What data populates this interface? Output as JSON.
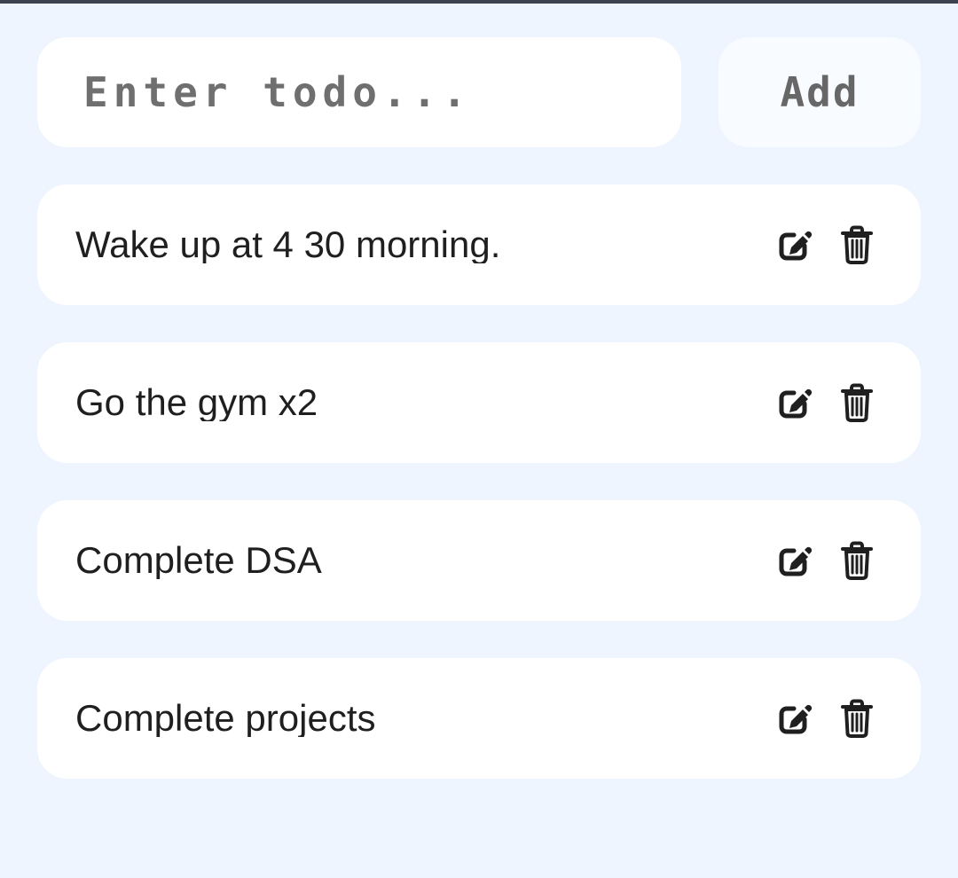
{
  "todo_input": {
    "placeholder": "Enter todo...",
    "value": ""
  },
  "add_button": {
    "label": "Add"
  },
  "todos": [
    {
      "text": "Wake up at 4 30 morning.",
      "edit_icon": "edit-icon",
      "delete_icon": "trash-icon"
    },
    {
      "text": "Go the gym x2",
      "edit_icon": "edit-icon",
      "delete_icon": "trash-icon"
    },
    {
      "text": "Complete DSA",
      "edit_icon": "edit-icon",
      "delete_icon": "trash-icon"
    },
    {
      "text": "Complete projects",
      "edit_icon": "edit-icon",
      "delete_icon": "trash-icon"
    }
  ],
  "colors": {
    "page_background": "#eef5ff",
    "card_background": "#ffffff",
    "button_background": "#f8fbff",
    "text": "#1f1f1f",
    "muted_text": "#6f6f6f"
  }
}
